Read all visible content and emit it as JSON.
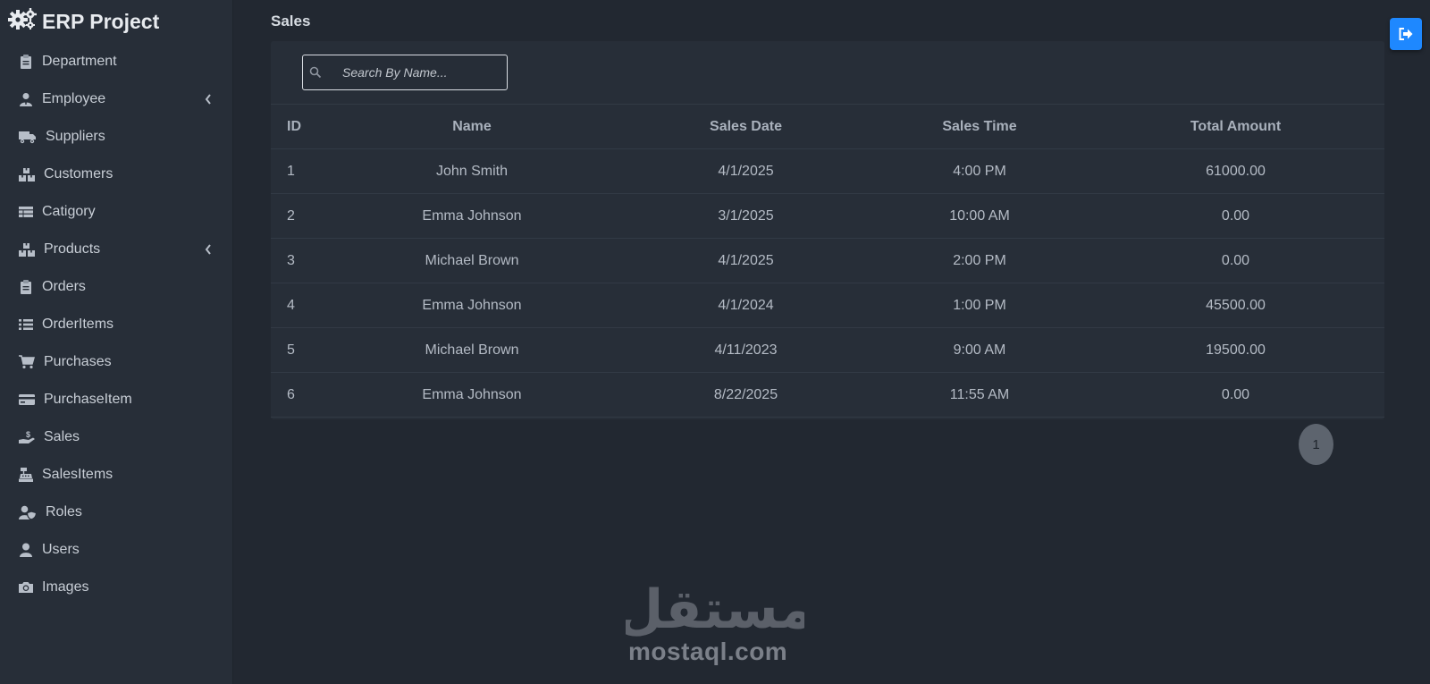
{
  "app": {
    "brand": "ERP Project"
  },
  "sidebar": {
    "items": [
      {
        "label": "Department",
        "icon": "clipboard-icon",
        "has_submenu": false
      },
      {
        "label": "Employee",
        "icon": "user-tie-icon",
        "has_submenu": true
      },
      {
        "label": "Suppliers",
        "icon": "truck-icon",
        "has_submenu": false
      },
      {
        "label": "Customers",
        "icon": "boxes-icon",
        "has_submenu": false
      },
      {
        "label": "Catigory",
        "icon": "table-icon",
        "has_submenu": false
      },
      {
        "label": "Products",
        "icon": "boxes-icon",
        "has_submenu": true
      },
      {
        "label": "Orders",
        "icon": "clipboard-icon",
        "has_submenu": false
      },
      {
        "label": "OrderItems",
        "icon": "list-icon",
        "has_submenu": false
      },
      {
        "label": "Purchases",
        "icon": "cart-icon",
        "has_submenu": false
      },
      {
        "label": "PurchaseItem",
        "icon": "credit-card-icon",
        "has_submenu": false
      },
      {
        "label": "Sales",
        "icon": "hand-dollar-icon",
        "has_submenu": false
      },
      {
        "label": "SalesItems",
        "icon": "cash-register-icon",
        "has_submenu": false
      },
      {
        "label": "Roles",
        "icon": "user-shield-icon",
        "has_submenu": false
      },
      {
        "label": "Users",
        "icon": "user-icon",
        "has_submenu": false
      },
      {
        "label": "Images",
        "icon": "camera-icon",
        "has_submenu": false
      }
    ]
  },
  "main": {
    "title": "Sales",
    "search": {
      "placeholder": "Search By Name...",
      "value": ""
    },
    "table": {
      "columns": [
        "ID",
        "Name",
        "Sales Date",
        "Sales Time",
        "Total Amount"
      ],
      "rows": [
        [
          "1",
          "John Smith",
          "4/1/2025",
          "4:00 PM",
          "61000.00"
        ],
        [
          "2",
          "Emma Johnson",
          "3/1/2025",
          "10:00 AM",
          "0.00"
        ],
        [
          "3",
          "Michael Brown",
          "4/1/2025",
          "2:00 PM",
          "0.00"
        ],
        [
          "4",
          "Emma Johnson",
          "4/1/2024",
          "1:00 PM",
          "45500.00"
        ],
        [
          "5",
          "Michael Brown",
          "4/11/2023",
          "9:00 AM",
          "19500.00"
        ],
        [
          "6",
          "Emma Johnson",
          "8/22/2025",
          "11:55 AM",
          "0.00"
        ]
      ]
    },
    "pagination": {
      "current_page": "1"
    }
  },
  "watermark": {
    "arabic": "مستقل",
    "latin": "mostaql.com"
  },
  "colors": {
    "accent": "#1e88ff",
    "background": "#222831",
    "sidebar": "#272e38"
  }
}
